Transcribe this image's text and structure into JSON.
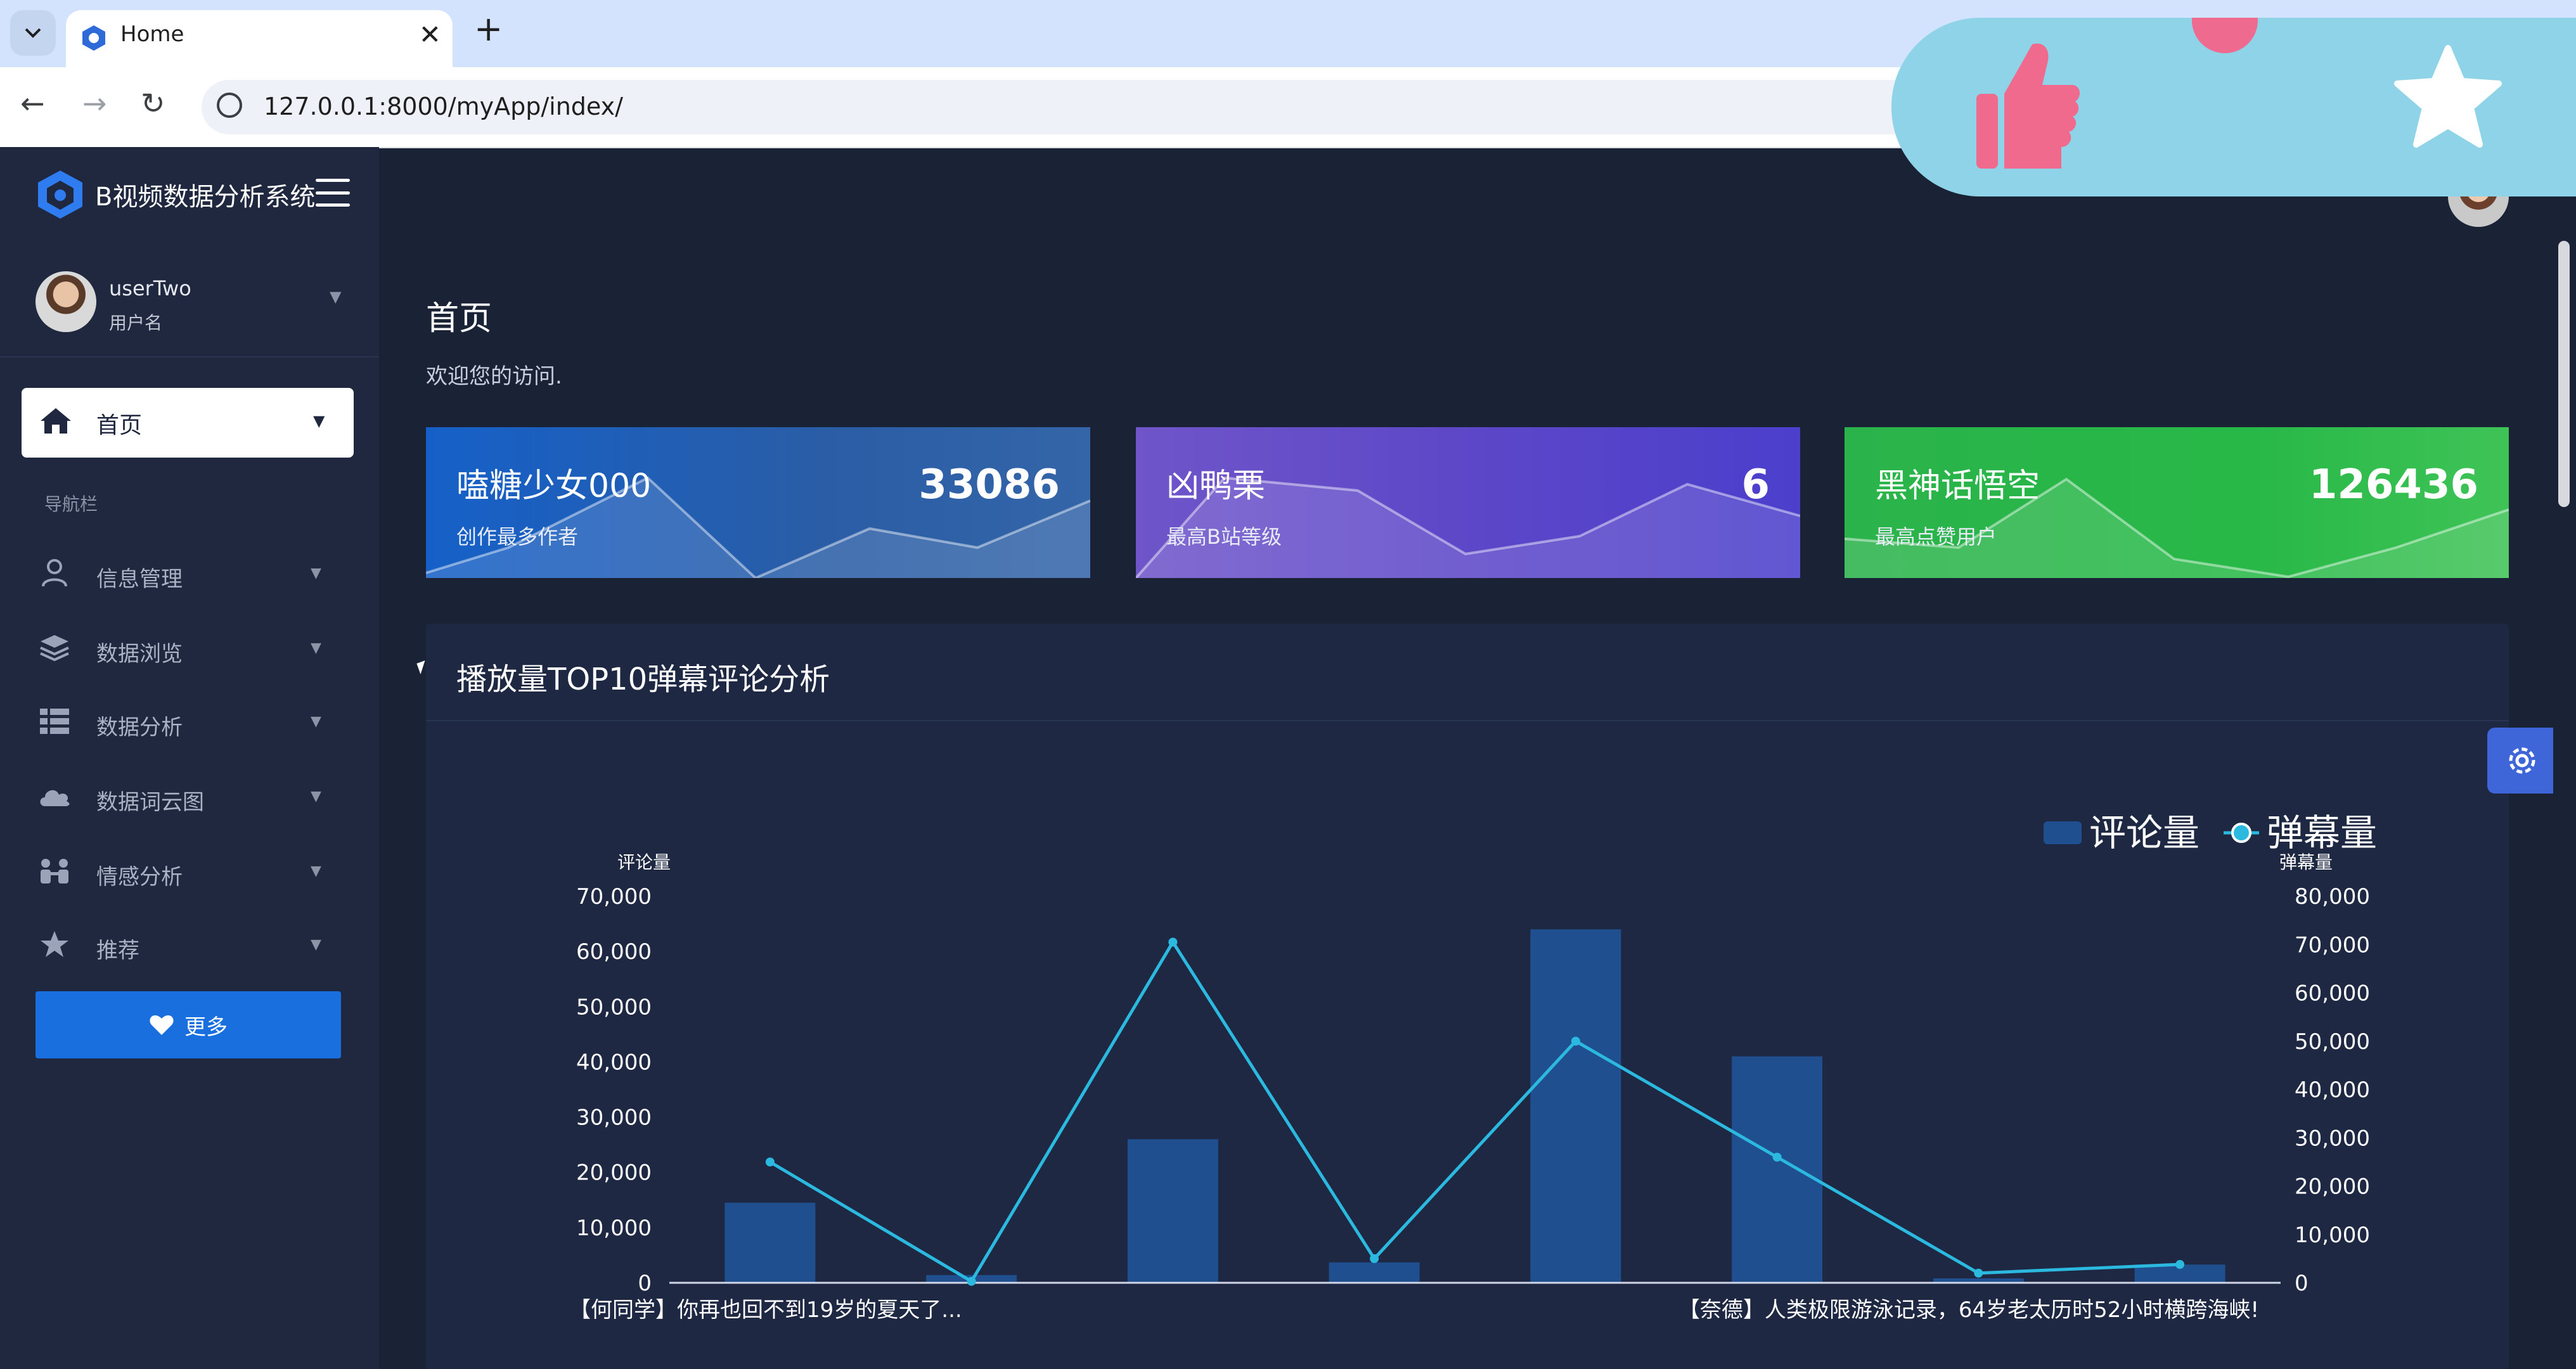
{
  "browser": {
    "tab_title": "Home",
    "url": "127.0.0.1:8000/myApp/index/"
  },
  "sidebar": {
    "brand": "B视频数据分析系统",
    "user": {
      "name": "userTwo",
      "role": "用户名"
    },
    "home_label": "首页",
    "nav_header": "导航栏",
    "items": [
      {
        "label": "信息管理",
        "icon": "user-icon"
      },
      {
        "label": "数据浏览",
        "icon": "layers-icon"
      },
      {
        "label": "数据分析",
        "icon": "list-icon"
      },
      {
        "label": "数据词云图",
        "icon": "cloud-icon"
      },
      {
        "label": "情感分析",
        "icon": "people-icon"
      },
      {
        "label": "推荐",
        "icon": "star-icon"
      }
    ],
    "more_label": "更多"
  },
  "page": {
    "title": "首页",
    "subtitle": "欢迎您的访问."
  },
  "cards": [
    {
      "title": "嗑糖少女000",
      "desc": "创作最多作者",
      "value": "33086",
      "color": "#1560c8"
    },
    {
      "title": "凶鸭栗",
      "desc": "最高B站等级",
      "value": "6",
      "color": "#5b46c8"
    },
    {
      "title": "黑神话悟空",
      "desc": "最高点赞用户",
      "value": "126436",
      "color": "#27b847"
    }
  ],
  "panel": {
    "title": "播放量TOP10弹幕评论分析"
  },
  "chart_data": {
    "type": "bar",
    "categories": [
      "【何同学】你再也回不到19岁的夏天了...",
      "",
      "",
      "",
      "",
      "",
      "",
      "【奈德】人类极限游泳记录，64岁老太历时52小时横跨海峡!"
    ],
    "series": [
      {
        "name": "评论量",
        "type": "bar",
        "axis": "left",
        "color": "#1f4f8f",
        "values": [
          14500,
          1400,
          26000,
          3700,
          64000,
          41000,
          800,
          3300
        ]
      },
      {
        "name": "弹幕量",
        "type": "line",
        "axis": "right",
        "color": "#2bb9e0",
        "values": [
          25000,
          300,
          70500,
          5000,
          50000,
          26000,
          2000,
          3800
        ]
      }
    ],
    "ylabel_left": "评论量",
    "ylabel_right": "弹幕量",
    "ylim_left": [
      0,
      70000
    ],
    "ylim_right": [
      0,
      80000
    ],
    "yticks_left": [
      "0",
      "10,000",
      "20,000",
      "30,000",
      "40,000",
      "50,000",
      "60,000",
      "70,000"
    ],
    "yticks_right": [
      "0",
      "10,000",
      "20,000",
      "30,000",
      "40,000",
      "50,000",
      "60,000",
      "70,000",
      "80,000"
    ],
    "legend": "top-right",
    "grid": false
  }
}
